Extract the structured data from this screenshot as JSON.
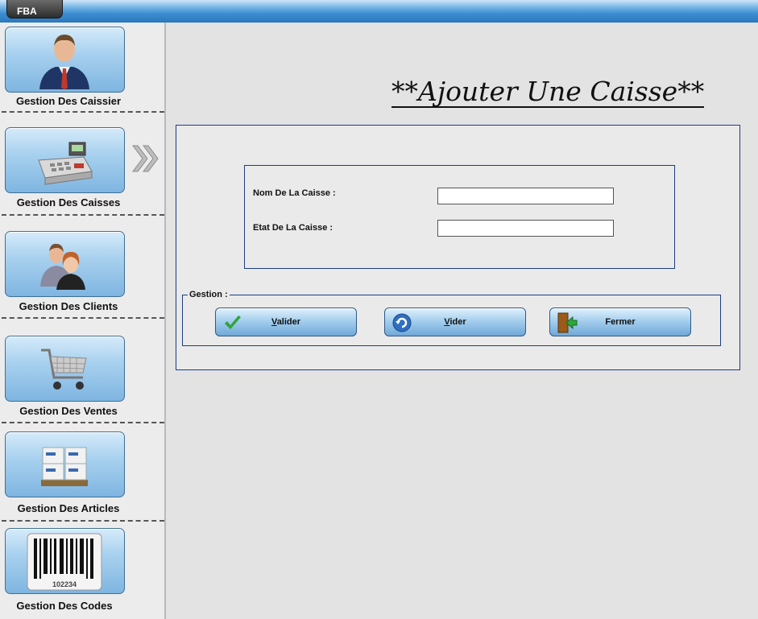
{
  "app": {
    "tab_label": "FBA"
  },
  "sidebar": {
    "items": [
      {
        "label": "Gestion Des Caissier",
        "icon": "person-icon"
      },
      {
        "label": "Gestion Des Caisses",
        "icon": "cash-register-icon"
      },
      {
        "label": "Gestion Des Clients",
        "icon": "clients-icon"
      },
      {
        "label": "Gestion Des Ventes",
        "icon": "shopping-cart-icon"
      },
      {
        "label": "Gestion Des Articles",
        "icon": "boxes-icon"
      },
      {
        "label": "Gestion Des Codes",
        "icon": "barcode-icon"
      }
    ],
    "active_index": 1,
    "barcode_number": "102234"
  },
  "form": {
    "title": "**Ajouter Une Caisse**",
    "nom_label": "Nom De La Caisse :",
    "nom_value": "",
    "etat_label": "Etat De La Caisse :",
    "etat_value": ""
  },
  "gestion": {
    "legend": "Gestion :",
    "valider_first": "V",
    "valider_rest": "alider",
    "vider_first": "V",
    "vider_rest": "ider",
    "fermer_label": "Fermer"
  },
  "colors": {
    "border": "#1d3d82",
    "button_blue": "#7eb5e0",
    "topbar": "#3d8dd0"
  }
}
